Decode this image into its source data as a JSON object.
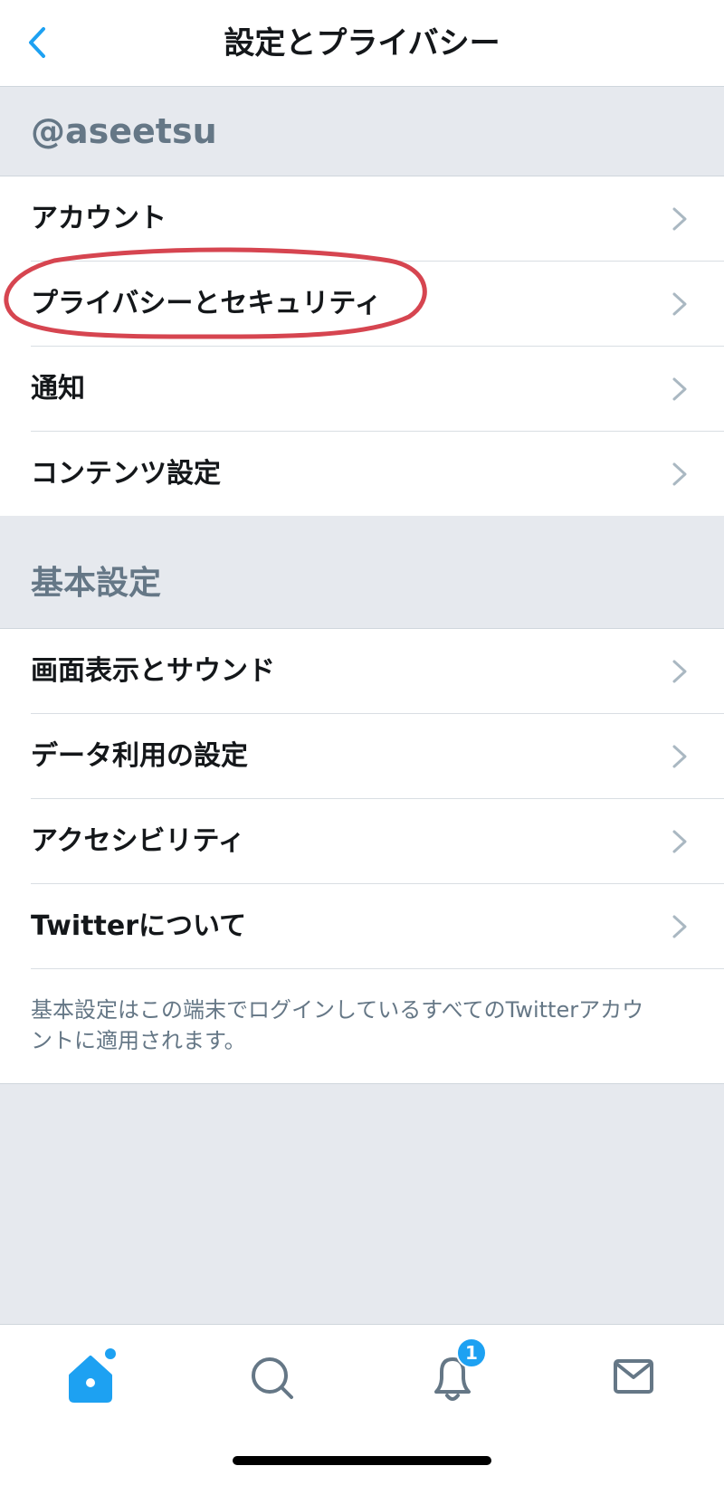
{
  "header": {
    "title": "設定とプライバシー",
    "back_icon": "chevron-left-icon"
  },
  "account_section": {
    "title": "@aseetsu",
    "items": [
      {
        "label": "アカウント"
      },
      {
        "label": "プライバシーとセキュリティ",
        "annotated": true
      },
      {
        "label": "通知"
      },
      {
        "label": "コンテンツ設定"
      }
    ]
  },
  "basic_section": {
    "title": "基本設定",
    "items": [
      {
        "label": "画面表示とサウンド"
      },
      {
        "label": "データ利用の設定"
      },
      {
        "label": "アクセシビリティ"
      },
      {
        "label": "Twitterについて"
      }
    ],
    "footer_note": "基本設定はこの端末でログインしているすべてのTwitterアカウントに適用されます。"
  },
  "tab_bar": {
    "tabs": [
      {
        "name": "home",
        "icon": "home-icon",
        "active": true
      },
      {
        "name": "search",
        "icon": "search-icon"
      },
      {
        "name": "notifications",
        "icon": "bell-icon",
        "badge": "1"
      },
      {
        "name": "messages",
        "icon": "envelope-icon"
      }
    ]
  },
  "colors": {
    "accent": "#1da1f2",
    "annotation": "#d64550",
    "section_bg": "#e6e9ee",
    "secondary_text": "#657786"
  }
}
